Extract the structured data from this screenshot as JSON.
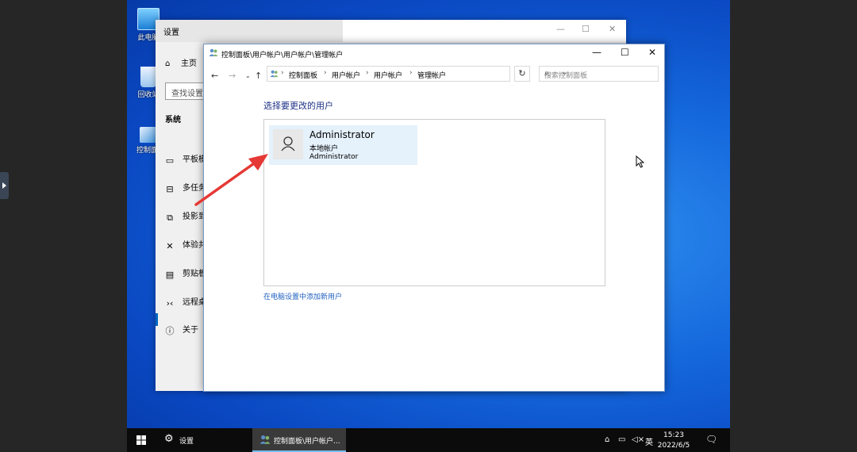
{
  "desktop": {
    "icons": [
      {
        "name": "this-pc",
        "label": "此电脑"
      },
      {
        "name": "recycle-bin",
        "label": "回收站"
      },
      {
        "name": "control-panel",
        "label": "控制面板"
      }
    ]
  },
  "settings_window": {
    "title": "设置",
    "home": "主页",
    "search_placeholder": "查找设置",
    "category": "系统",
    "items": [
      {
        "label": "平板模式",
        "icon": "tablet-icon"
      },
      {
        "label": "多任务处理",
        "icon": "multitasking-icon"
      },
      {
        "label": "投影到此电脑",
        "icon": "projection-icon"
      },
      {
        "label": "体验共享",
        "icon": "shared-experience-icon"
      },
      {
        "label": "剪贴板",
        "icon": "clipboard-icon"
      },
      {
        "label": "远程桌面",
        "icon": "remote-desktop-icon"
      },
      {
        "label": "关于",
        "icon": "info-icon"
      }
    ],
    "active_item": "远程桌面"
  },
  "cp_window": {
    "title": "控制面板\\用户帐户\\用户帐户\\管理帐户",
    "breadcrumb": [
      "控制面板",
      "用户帐户",
      "用户帐户",
      "管理帐户"
    ],
    "search_placeholder": "搜索控制面板",
    "heading": "选择要更改的用户",
    "account": {
      "name": "Administrator",
      "type": "本地帐户",
      "group": "Administrator"
    },
    "add_user_link": "在电脑设置中添加新用户"
  },
  "taskbar": {
    "settings_label": "设置",
    "cp_label": "控制面板\\用户帐户...",
    "ime": "英",
    "time": "15:23",
    "date": "2022/6/5"
  },
  "colors": {
    "accent": "#0067c0",
    "heading_blue": "#1e3287",
    "link_blue": "#1f5fbf",
    "selection": "#e5f1fb",
    "annotation_arrow": "#e53935"
  }
}
